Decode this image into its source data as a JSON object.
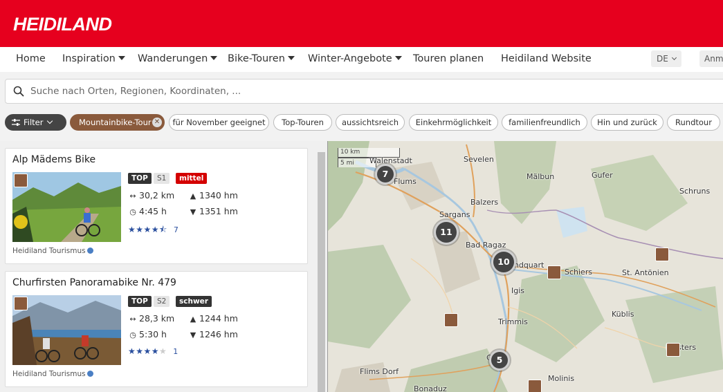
{
  "brand": {
    "logo_text": "HEIDILAND",
    "color": "#e6001e"
  },
  "nav": {
    "items": [
      {
        "label": "Home",
        "dropdown": false
      },
      {
        "label": "Inspiration",
        "dropdown": true
      },
      {
        "label": "Wanderungen",
        "dropdown": true
      },
      {
        "label": "Bike-Touren",
        "dropdown": true
      },
      {
        "label": "Winter-Angebote",
        "dropdown": true
      },
      {
        "label": "Touren planen",
        "dropdown": false
      },
      {
        "label": "Heidiland Website",
        "dropdown": false
      }
    ],
    "language": "DE",
    "login": "Anm"
  },
  "search": {
    "placeholder": "Suche nach Orten, Regionen, Koordinaten, ...",
    "icon": "search-icon"
  },
  "filters": {
    "filter_button": "Filter",
    "active": "Mountainbike-Tour",
    "chips": [
      "für November geeignet",
      "Top-Touren",
      "aussichtsreich",
      "Einkehrmöglichkeit",
      "familienfreundlich",
      "Hin und zurück",
      "Rundtour"
    ]
  },
  "tours": [
    {
      "title": "Alp Mädems Bike",
      "tags": [
        "TOP",
        "S1",
        "mittel"
      ],
      "distance": "30,2 km",
      "duration": "4:45 h",
      "ascent": "1340 hm",
      "descent": "1351 hm",
      "rating": 4.5,
      "rating_count": "7",
      "source": "Heidiland Tourismus",
      "difficulty_color": "#d40000"
    },
    {
      "title": "Churfirsten Panoramabike Nr. 479",
      "tags": [
        "TOP",
        "S2",
        "schwer"
      ],
      "distance": "28,3 km",
      "duration": "5:30 h",
      "ascent": "1244 hm",
      "descent": "1246 hm",
      "rating": 4,
      "rating_count": "1",
      "source": "Heidiland Tourismus",
      "difficulty_color": "#333333"
    }
  ],
  "map": {
    "scale": {
      "km": "10 km",
      "mi": "5 mi"
    },
    "clusters": [
      "7",
      "11",
      "10",
      "5"
    ],
    "places": [
      "Walenstadt",
      "Sevelen",
      "Flums",
      "Mälbun",
      "Gufer",
      "Schruns",
      "Sargans",
      "Balzers",
      "Bad Ragaz",
      "Landquart",
      "Schiers",
      "St. Antönien",
      "Igis",
      "Trimmis",
      "Küblis",
      "Klosters",
      "Flims Dorf",
      "Chur",
      "Molinis",
      "Bonaduz"
    ]
  }
}
